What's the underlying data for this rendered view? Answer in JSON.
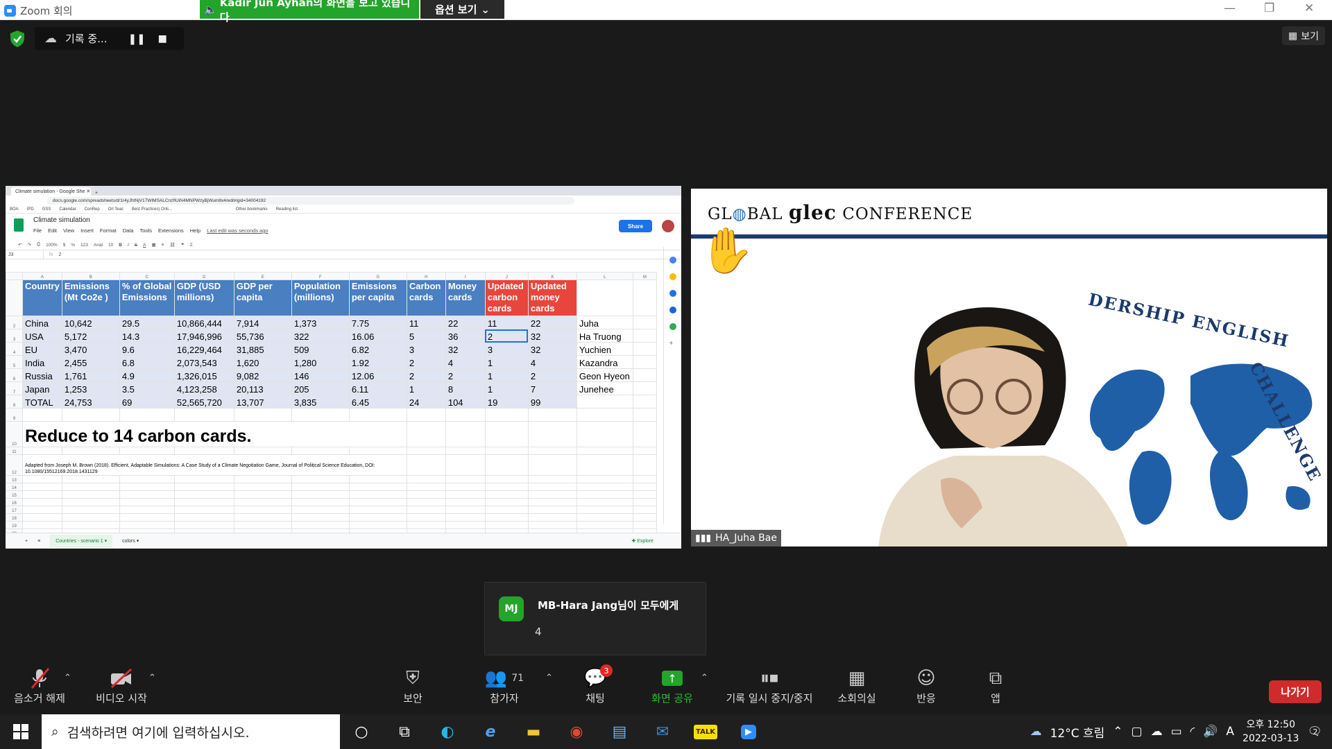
{
  "titlebar": {
    "app_title": "Zoom 회의",
    "share_banner": "Kadir Jun Ayhan의 화면을 보고 있습니다",
    "view_options": "옵션 보기"
  },
  "recording": {
    "label": "기록 중..."
  },
  "view_button": "보기",
  "sheet": {
    "browser_tab": "Climate simulation - Google She",
    "url": "docs.google.com/spreadsheets/d/1r4yJhtNjV17WIMSALCnzfIUiN4MNPWzyBjWum8x4/edit#gid=34004192",
    "bookmarks": [
      "BOA",
      "IPD",
      "GSS",
      "Calendar",
      "ConRep",
      "Orl Teac",
      "Best Practices) Onli...",
      "Other bookmarks",
      "Reading list"
    ],
    "doc_title": "Climate simulation",
    "menus": [
      "File",
      "Edit",
      "View",
      "Insert",
      "Format",
      "Data",
      "Tools",
      "Extensions",
      "Help"
    ],
    "last_edit": "Last edit was seconds ago",
    "share_label": "Share",
    "toolbar": {
      "zoom": "100%",
      "currency": "$",
      "percent": "%",
      "format": "123",
      "font": "Arial",
      "size": "10"
    },
    "formula": {
      "cell": "J3",
      "value": "2"
    },
    "col_letters": [
      "A",
      "B",
      "C",
      "D",
      "E",
      "F",
      "G",
      "H",
      "I",
      "J",
      "K",
      "L",
      "M"
    ],
    "headers": [
      "Country",
      "Emissions (Mt Co2e )",
      "% of Global Emissions",
      "GDP (USD millions)",
      "GDP per capita",
      "Population (millions)",
      "Emissions per capita",
      "Carbon cards",
      "Money cards",
      "Updated carbon cards",
      "Updated money cards"
    ],
    "rows": [
      [
        "China",
        "10,642",
        "29.5",
        "10,866,444",
        "7,914",
        "1,373",
        "7.75",
        "11",
        "22",
        "11",
        "22",
        "Juha"
      ],
      [
        "USA",
        "5,172",
        "14.3",
        "17,946,996",
        "55,736",
        "322",
        "16.06",
        "5",
        "36",
        "2",
        "32",
        "Ha Truong"
      ],
      [
        "EU",
        "3,470",
        "9.6",
        "16,229,464",
        "31,885",
        "509",
        "6.82",
        "3",
        "32",
        "3",
        "32",
        "Yuchien"
      ],
      [
        "India",
        "2,455",
        "6.8",
        "2,073,543",
        "1,620",
        "1,280",
        "1.92",
        "2",
        "4",
        "1",
        "4",
        "Kazandra"
      ],
      [
        "Russia",
        "1,761",
        "4.9",
        "1,326,015",
        "9,082",
        "146",
        "12.06",
        "2",
        "2",
        "1",
        "2",
        "Geon Hyeon"
      ],
      [
        "Japan",
        "1,253",
        "3.5",
        "4,123,258",
        "20,113",
        "205",
        "6.11",
        "1",
        "8",
        "1",
        "7",
        "Junehee"
      ],
      [
        "TOTAL",
        "24,753",
        "69",
        "52,565,720",
        "13,707",
        "3,835",
        "6.45",
        "24",
        "104",
        "19",
        "99",
        ""
      ]
    ],
    "big_note": "Reduce to 14 carbon cards.",
    "citation": "Adapted from Joseph M. Brown (2018). Efficient, Adaptable Simulations: A Case Study of a Climate Negotiation Game, Journal of Political Science Education, DOI: 10.1080/15512169.2018.1431129",
    "sheet_tabs": [
      "Countries - scenario 1",
      "colors"
    ],
    "explore": "Explore"
  },
  "video": {
    "conference_prefix": "GL",
    "conference_mid": "BAL",
    "conference_brand": "glec",
    "conference_suffix": "CONFERENCE",
    "arc_text_1": "DERSHIP ENGLISH",
    "arc_text_2": "CHALLENGE",
    "participant_name": "HA_Juha Bae"
  },
  "chat_popup": {
    "avatar": "MJ",
    "from": "MB-Hara Jang님이 모두에게",
    "message": "4"
  },
  "controls": {
    "unmute": "음소거 해제",
    "start_video": "비디오 시작",
    "security": "보안",
    "participants": "참가자",
    "participant_count": "71",
    "chat": "채팅",
    "chat_badge": "3",
    "share_screen": "화면 공유",
    "pause_stop_recording": "기록 일시 중지/중지",
    "breakout": "소회의실",
    "reactions": "반응",
    "apps": "앱",
    "leave": "나가기"
  },
  "taskbar": {
    "search_placeholder": "검색하려면 여기에 입력하십시오.",
    "weather": "12°C 흐림",
    "ime": "A",
    "time": "오후 12:50",
    "date": "2022-03-13",
    "notification_count": "2"
  },
  "colors": {
    "zoom_green": "#23a42b",
    "header_blue": "#4a7fc1",
    "header_red": "#e8453c",
    "leave_red": "#d02b2b"
  }
}
